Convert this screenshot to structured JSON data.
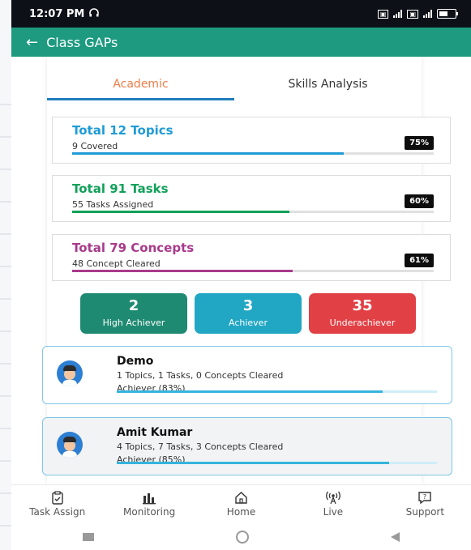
{
  "status_bar": {
    "time": "12:07 PM"
  },
  "app_bar": {
    "title": "Class GAPs"
  },
  "tabs": [
    {
      "label": "Academic",
      "active": true
    },
    {
      "label": "Skills Analysis",
      "active": false
    }
  ],
  "stats": [
    {
      "title": "Total 12 Topics",
      "subtitle": "9 Covered",
      "percent_label": "75%",
      "progress": 0.75,
      "color": "#1f9bd6"
    },
    {
      "title": "Total 91 Tasks",
      "subtitle": "55 Tasks Assigned",
      "percent_label": "60%",
      "progress": 0.6,
      "color": "#11a05a"
    },
    {
      "title": "Total 79 Concepts",
      "subtitle": "48 Concept Cleared",
      "percent_label": "61%",
      "progress": 0.61,
      "color": "#a93a8c"
    }
  ],
  "achievement": [
    {
      "count": "2",
      "label": "High Achiever",
      "color": "#1f8a72"
    },
    {
      "count": "3",
      "label": "Achiever",
      "color": "#21a7c4"
    },
    {
      "count": "35",
      "label": "Underachiever",
      "color": "#e14045"
    }
  ],
  "students": [
    {
      "name": "Demo",
      "info": "1 Topics, 1 Tasks, 0 Concepts Cleared",
      "level": "Achiever (83%)",
      "progress": 0.83
    },
    {
      "name": "Amit Kumar",
      "info": "4 Topics, 7 Tasks, 3 Concepts Cleared",
      "level": "Achiever (85%)",
      "progress": 0.85
    }
  ],
  "bottom_nav": [
    {
      "label": "Task Assign",
      "icon": "clipboard-icon"
    },
    {
      "label": "Monitoring",
      "icon": "bar-chart-icon"
    },
    {
      "label": "Home",
      "icon": "home-icon"
    },
    {
      "label": "Live",
      "icon": "broadcast-icon"
    },
    {
      "label": "Support",
      "icon": "chat-support-icon"
    }
  ]
}
